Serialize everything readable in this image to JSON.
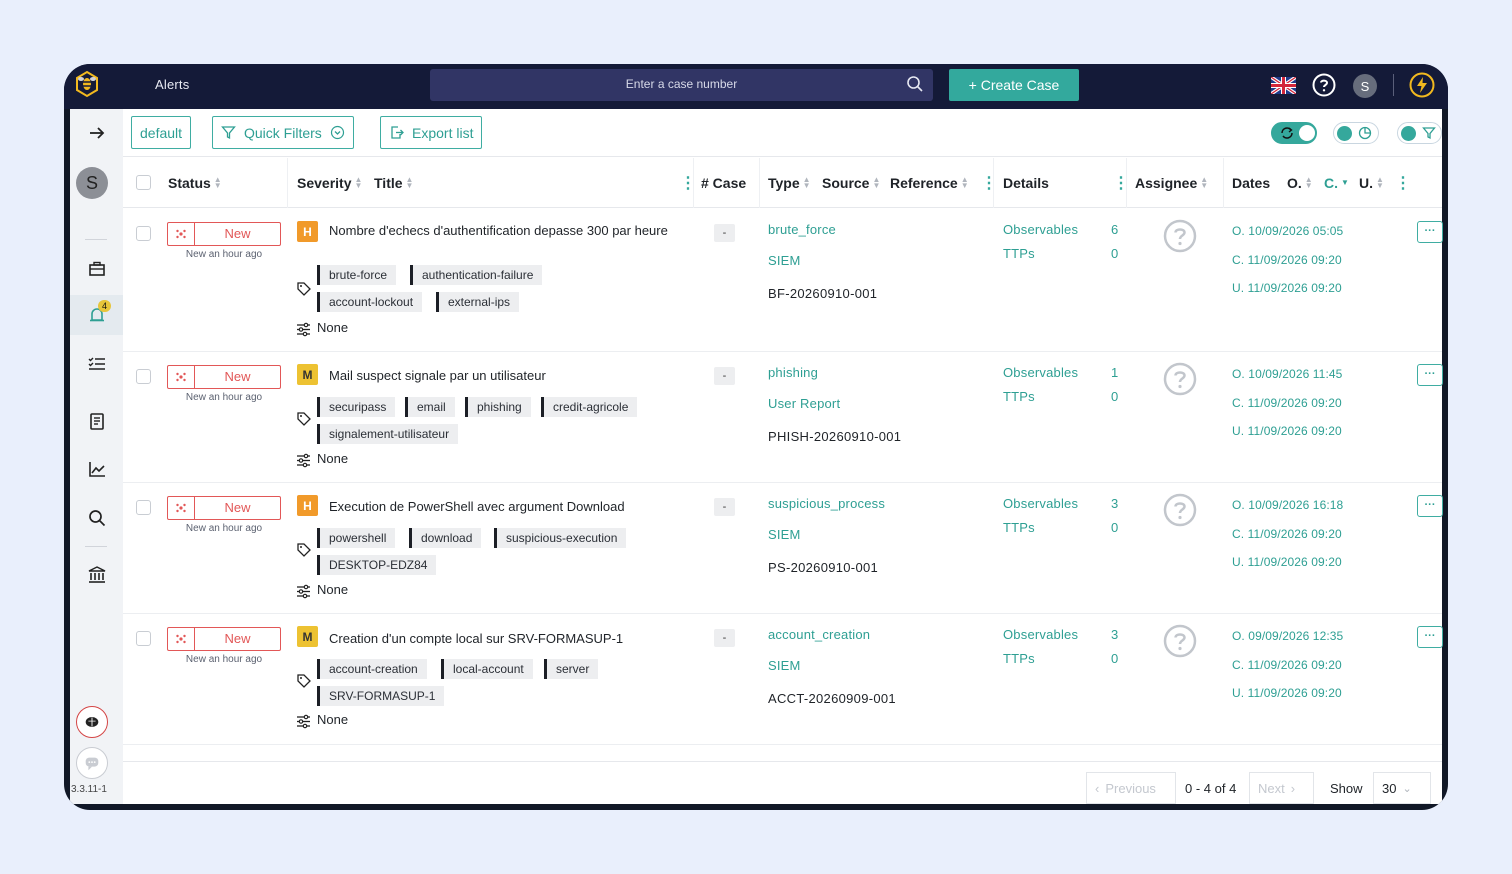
{
  "header": {
    "app_title": "Alerts",
    "search_placeholder": "Enter a case number",
    "create_case_label": "+ Create Case",
    "avatar_initial": "S"
  },
  "sidebar": {
    "avatar_initial": "S",
    "alerts_badge": "4",
    "version": "3.3.11-1"
  },
  "toolbar": {
    "default_label": "default",
    "quick_filters_label": "Quick Filters",
    "export_label": "Export list"
  },
  "columns": {
    "status": "Status",
    "severity": "Severity",
    "title": "Title",
    "case": "# Case",
    "type": "Type",
    "source": "Source",
    "reference": "Reference",
    "details": "Details",
    "assignee": "Assignee",
    "dates": "Dates",
    "date_o": "O.",
    "date_c": "C.",
    "date_u": "U."
  },
  "alerts": [
    {
      "status": "New",
      "status_time": "New an hour ago",
      "severity": "H",
      "title": "Nombre d'echecs d'authentification depasse 300 par heure",
      "tags": [
        "brute-force",
        "authentication-failure",
        "account-lockout",
        "external-ips"
      ],
      "note": "None",
      "case": "-",
      "type": "brute_force",
      "source": "SIEM",
      "reference": "BF-20260910-001",
      "observables_label": "Observables",
      "observables": "6",
      "ttps_label": "TTPs",
      "ttps": "0",
      "date_o": "O. 10/09/2026 05:05",
      "date_c": "C. 11/09/2026 09:20",
      "date_u": "U. 11/09/2026 09:20",
      "more": "···"
    },
    {
      "status": "New",
      "status_time": "New an hour ago",
      "severity": "M",
      "title": "Mail suspect signale par un utilisateur",
      "tags": [
        "securipass",
        "email",
        "phishing",
        "credit-agricole",
        "signalement-utilisateur"
      ],
      "note": "None",
      "case": "-",
      "type": "phishing",
      "source": "User Report",
      "reference": "PHISH-20260910-001",
      "observables_label": "Observables",
      "observables": "1",
      "ttps_label": "TTPs",
      "ttps": "0",
      "date_o": "O. 10/09/2026 11:45",
      "date_c": "C. 11/09/2026 09:20",
      "date_u": "U. 11/09/2026 09:20",
      "more": "···"
    },
    {
      "status": "New",
      "status_time": "New an hour ago",
      "severity": "H",
      "title": "Execution de PowerShell avec argument Download",
      "tags": [
        "powershell",
        "download",
        "suspicious-execution",
        "DESKTOP-EDZ84"
      ],
      "note": "None",
      "case": "-",
      "type": "suspicious_process",
      "source": "SIEM",
      "reference": "PS-20260910-001",
      "observables_label": "Observables",
      "observables": "3",
      "ttps_label": "TTPs",
      "ttps": "0",
      "date_o": "O. 10/09/2026 16:18",
      "date_c": "C. 11/09/2026 09:20",
      "date_u": "U. 11/09/2026 09:20",
      "more": "···"
    },
    {
      "status": "New",
      "status_time": "New an hour ago",
      "severity": "M",
      "title": "Creation d'un compte local sur SRV-FORMASUP-1",
      "tags": [
        "account-creation",
        "local-account",
        "server",
        "SRV-FORMASUP-1"
      ],
      "note": "None",
      "case": "-",
      "type": "account_creation",
      "source": "SIEM",
      "reference": "ACCT-20260909-001",
      "observables_label": "Observables",
      "observables": "3",
      "ttps_label": "TTPs",
      "ttps": "0",
      "date_o": "O. 09/09/2026 12:35",
      "date_c": "C. 11/09/2026 09:20",
      "date_u": "U. 11/09/2026 09:20",
      "more": "···"
    }
  ],
  "pagination": {
    "previous": "Previous",
    "info": "0 - 4 of 4",
    "next": "Next",
    "show_label": "Show",
    "page_size": "30"
  },
  "colors": {
    "accent": "#35a89c",
    "topbar": "#141a38",
    "status_new": "#e25757",
    "severity_high": "#f19a2a",
    "severity_medium": "#edc232"
  }
}
